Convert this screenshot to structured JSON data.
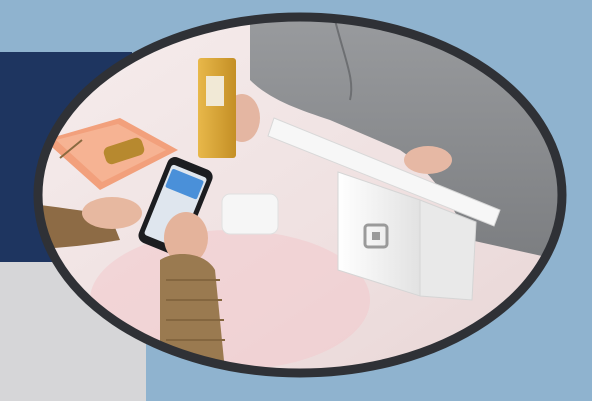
{
  "colors": {
    "background": "#8fb3cf",
    "navy_block": "#1e3560",
    "grey_block": "#d6d6d8",
    "frame_ring": "#2f3136",
    "table": "#f1e6e6",
    "sweater_grey": "#8a8c8e",
    "gold_device": "#d9a63a",
    "terminal_white": "#f4f4f4"
  },
  "icons": [
    "square-logo-icon"
  ],
  "photo": {
    "subject": "contactless-phone-payment-at-counter"
  }
}
